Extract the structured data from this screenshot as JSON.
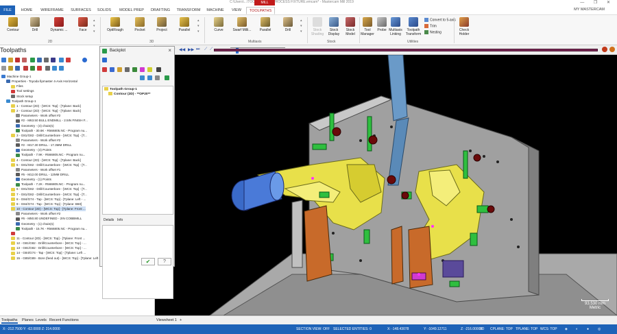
{
  "window": {
    "title": "C:\\Users\\...\\TOOL HOLDER PROCESS FIXTURE.emcam* - Mastercam Mill 2019",
    "context_tab": "MILL",
    "controls": [
      "—",
      "❐",
      "✕"
    ]
  },
  "tabs": [
    "FILE",
    "HOME",
    "WIREFRAME",
    "SURFACES",
    "SOLIDS",
    "MODEL PREP",
    "DRAFTING",
    "TRANSFORM",
    "MACHINE",
    "VIEW",
    "TOOLPATHS"
  ],
  "account": "MY MASTERCAM",
  "ribbon": {
    "groups": [
      {
        "label": "2D",
        "items": [
          "Contour",
          "Drill",
          "Dynamic ...",
          "Face"
        ]
      },
      {
        "label": "3D",
        "items": [
          "OptiRough",
          "Pocket",
          "Project",
          "Parallel"
        ]
      },
      {
        "label": "Multiaxis",
        "items": [
          "Curve",
          "Swarf Milli...",
          "Parallel",
          "Drill"
        ]
      },
      {
        "label": "Stock",
        "items": [
          "Stock Shading",
          "Stock Display",
          "Stock Model"
        ]
      },
      {
        "label": "Utilities",
        "items": [
          "Tool Manager",
          "Probe",
          "Multiaxis Linking",
          "Toolpath Transform"
        ]
      },
      {
        "label": "",
        "items": [
          "Check Holder"
        ]
      }
    ],
    "utilities_small": [
      "Convert to 5-axis",
      "Trim",
      "Nesting"
    ]
  },
  "colors": {
    "accent": "#1e63b8",
    "context": "#c11a1a",
    "track": "#7a2a56",
    "selection": "#cfe0f5"
  },
  "left_panel": {
    "title": "Toolpaths",
    "tree": [
      {
        "text": "Machine Group-1",
        "indent": 0,
        "icon": "machine-icon"
      },
      {
        "text": "Properties - Toyoda fipmaster 4-Axis Horizontal",
        "indent": 1,
        "icon": "properties-icon"
      },
      {
        "text": "Files",
        "indent": 2,
        "icon": "files-icon"
      },
      {
        "text": "Tool settings",
        "indent": 2,
        "icon": "tool-settings-icon"
      },
      {
        "text": "Stock setup",
        "indent": 2,
        "icon": "stock-setup-icon"
      },
      {
        "text": "Toolpath Group-1",
        "indent": 1,
        "icon": "group-icon"
      },
      {
        "text": "1 - Contour (2D) - [WCS: Top] - [Tplane: Back]",
        "indent": 2,
        "icon": "folder-icon"
      },
      {
        "text": "2 - Contour (2D) - [WCS: Top] - [Tplane: Back]",
        "indent": 2,
        "icon": "folder-icon"
      },
      {
        "text": "Parameters - Work offset #2",
        "indent": 3,
        "icon": "params-icon"
      },
      {
        "text": "#2 - M63.50 BULL ENDMILL - 2.5IN FINISH F...",
        "indent": 3,
        "icon": "tool-icon"
      },
      {
        "text": "Geometry - (4) chain(s)",
        "indent": 3,
        "icon": "geometry-icon"
      },
      {
        "text": "Toolpath - 30.6K - R566805.NC - Program nu...",
        "indent": 3,
        "icon": "toolpath-icon"
      },
      {
        "text": "3 - G81/G82 - Drill/Counterbore - [WCS: Top] - [T...",
        "indent": 2,
        "icon": "folder-icon"
      },
      {
        "text": "Parameters - Work offset #2",
        "indent": 3,
        "icon": "params-icon"
      },
      {
        "text": "#2 - M17.30 DRILL - 17.3MM DRILL",
        "indent": 3,
        "icon": "tool-icon"
      },
      {
        "text": "Geometry - (4) Points",
        "indent": 3,
        "icon": "geometry-icon"
      },
      {
        "text": "Toolpath - 7.9K - R566805.NC - Program nu...",
        "indent": 3,
        "icon": "toolpath-icon"
      },
      {
        "text": "4 - Contour (2D) - [WCS: Top] - [Tplane: Back]",
        "indent": 2,
        "icon": "folder-icon"
      },
      {
        "text": "5 - G81/G82 - Drill/Counterbore - [WCS: Top] - [T...",
        "indent": 2,
        "icon": "folder-icon"
      },
      {
        "text": "Parameters - Work offset #1",
        "indent": 3,
        "icon": "params-icon"
      },
      {
        "text": "#5 - M12.00 DRILL - 12MM DRILL",
        "indent": 3,
        "icon": "tool-icon"
      },
      {
        "text": "Geometry - (1) Points",
        "indent": 3,
        "icon": "geometry-icon"
      },
      {
        "text": "Toolpath - 7.2K - R566805.NC - Program nu...",
        "indent": 3,
        "icon": "toolpath-icon"
      },
      {
        "text": "6 - G81/G82 - Drill/Counterbore - [WCS: Top] - [T...",
        "indent": 2,
        "icon": "folder-icon"
      },
      {
        "text": "7 - G81/G82 - Drill/Counterbore - [WCS: Top] - [T...",
        "indent": 2,
        "icon": "folder-icon"
      },
      {
        "text": "8 - G84/G74 - Tap - [WCS: Top] - [Tplane: Left - ...",
        "indent": 2,
        "icon": "folder-icon"
      },
      {
        "text": "9 - G84/G74 - Tap - [WCS: Top] - [Tplane: B60]",
        "indent": 2,
        "icon": "folder-icon"
      },
      {
        "text": "10 - Contour (2D) - [WCS: Top] - [Tplane: Front ...",
        "indent": 2,
        "icon": "folder-icon",
        "selected": true
      },
      {
        "text": "Parameters - Work offset #2",
        "indent": 3,
        "icon": "params-icon"
      },
      {
        "text": "#6 - M50.80 UNDEFINED - 2IN COBBMILL",
        "indent": 3,
        "icon": "tool-icon"
      },
      {
        "text": "Geometry - (1) chain(s)",
        "indent": 3,
        "icon": "geometry-icon"
      },
      {
        "text": "Toolpath - 15.7K - R566805.NC - Program nu...",
        "indent": 3,
        "icon": "toolpath-icon"
      },
      {
        "text": "",
        "indent": 2,
        "icon": "insert-arrow-icon"
      },
      {
        "text": "11 - Contour (2D) - [WCS: Top] - [Tplane: Front ...",
        "indent": 2,
        "icon": "folder-icon"
      },
      {
        "text": "12 - G81/G82 - Drill/Counterbore - [WCS: Top] - ...",
        "indent": 2,
        "icon": "folder-icon"
      },
      {
        "text": "13 - G81/G82 - Drill/Counterbore - [WCS: Top] - ...",
        "indent": 2,
        "icon": "folder-icon"
      },
      {
        "text": "14 - G84/G74 - Tap - [WCS: Top] - [Tplane: Left ...",
        "indent": 2,
        "icon": "folder-icon"
      },
      {
        "text": "15 - G85/G89 - Bore (feed out) - [WCS: Top] - [Tplane: Left - OP20]",
        "indent": 2,
        "icon": "folder-icon"
      }
    ]
  },
  "backplot": {
    "title": "Backplot",
    "close": "×",
    "tree": [
      "Toolpath Group-1",
      "Contour (2D) - **OP20**"
    ],
    "tabs": [
      "Details",
      "Info"
    ],
    "ok": "✔",
    "help": "?"
  },
  "viewport": {
    "scale_value": "93.530 mm",
    "scale_unit": "Metric"
  },
  "bottom_tabs": [
    "Toolpaths",
    "Planes",
    "Levels",
    "Recent Functions"
  ],
  "viewsheet": "Viewsheet 1",
  "status": {
    "left_coords": "X: -212.7500  Y: -62.0000  Z: 214.0000",
    "section_view": "SECTION VIEW: OFF",
    "selected_entities": "SELECTED ENTITIES: 0",
    "x": "X: -148.43078",
    "y": "Y: -1049.12711",
    "z": "Z: -216.00000",
    "dim": "3D",
    "cplane": "CPLANE: TOP",
    "tplane": "TPLANE: TOP",
    "wcs": "WCS: TOP"
  }
}
